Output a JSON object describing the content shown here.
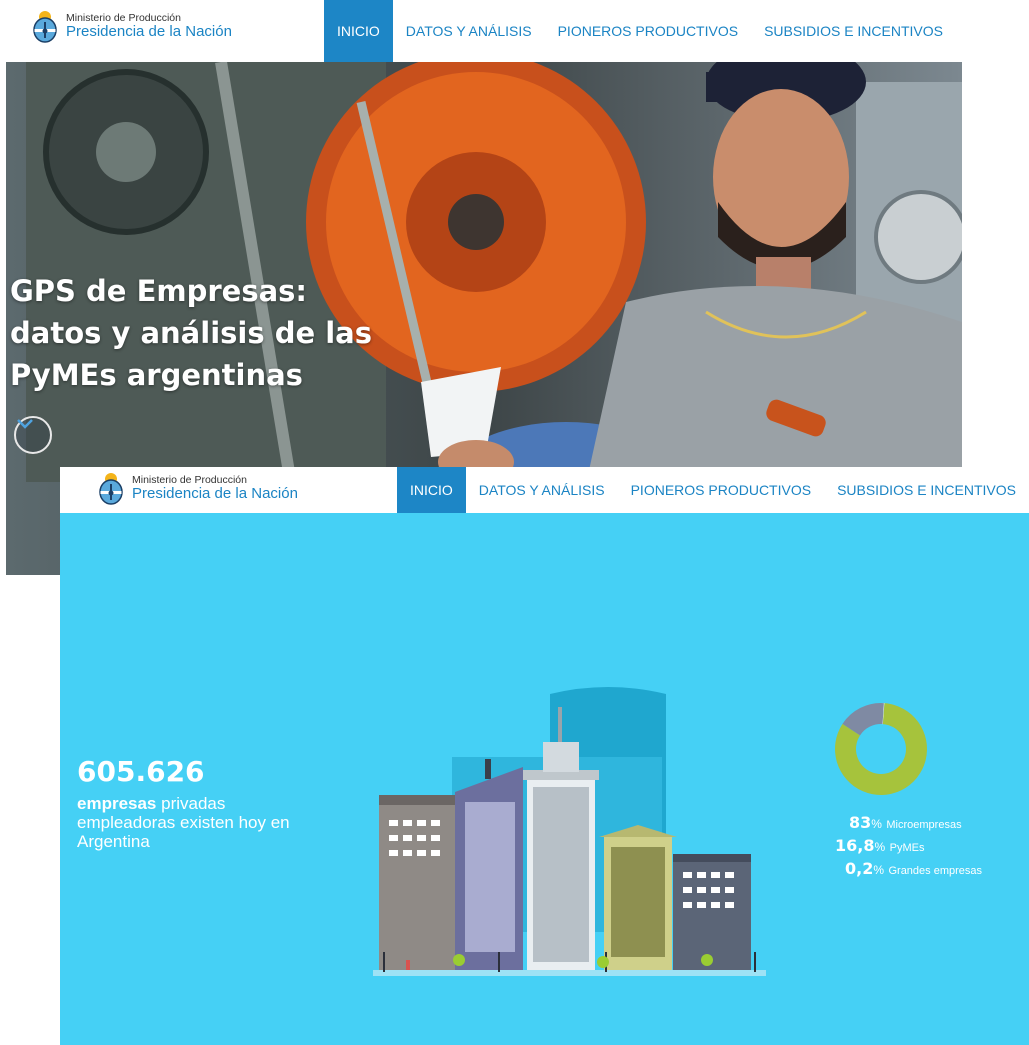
{
  "screenshot_top": {
    "brand": {
      "ministry": "Ministerio de Producción",
      "presidency": "Presidencia de la Nación"
    },
    "nav": [
      "INICIO",
      "DATOS Y ANÁLISIS",
      "PIONEROS PRODUCTIVOS",
      "SUBSIDIOS E INCENTIVOS"
    ],
    "active_nav": "INICIO",
    "hero": {
      "title_lines": [
        "GPS de Empresas:",
        "datos y análisis de las",
        "PyMEs argentinas"
      ],
      "scroll_icon": "chevron-down-icon"
    }
  },
  "screenshot_bottom": {
    "brand": {
      "ministry": "Ministerio de Producción",
      "presidency": "Presidencia de la Nación"
    },
    "nav": [
      "INICIO",
      "DATOS Y ANÁLISIS",
      "PIONEROS PRODUCTIVOS",
      "SUBSIDIOS E INCENTIVOS"
    ],
    "active_nav": "INICIO",
    "stat": {
      "number": "605.626",
      "emphasis": "empresas",
      "text": " privadas empleadoras existen hoy en Argentina"
    },
    "breakdown": [
      {
        "value": "83",
        "unit": "%",
        "label": "Microempresas",
        "share": 0.83,
        "color": "#a6c33c"
      },
      {
        "value": "16,8",
        "unit": "%",
        "label": "PyMEs",
        "share": 0.168,
        "color": "#7f8aa3"
      },
      {
        "value": "0,2",
        "unit": "%",
        "label": "Grandes empresas",
        "share": 0.002,
        "color": "#ffffff"
      }
    ]
  },
  "colors": {
    "brand_blue": "#1b84c4",
    "nav_active_bg": "#1d86c6",
    "infographic_bg": "#45d0f5"
  }
}
